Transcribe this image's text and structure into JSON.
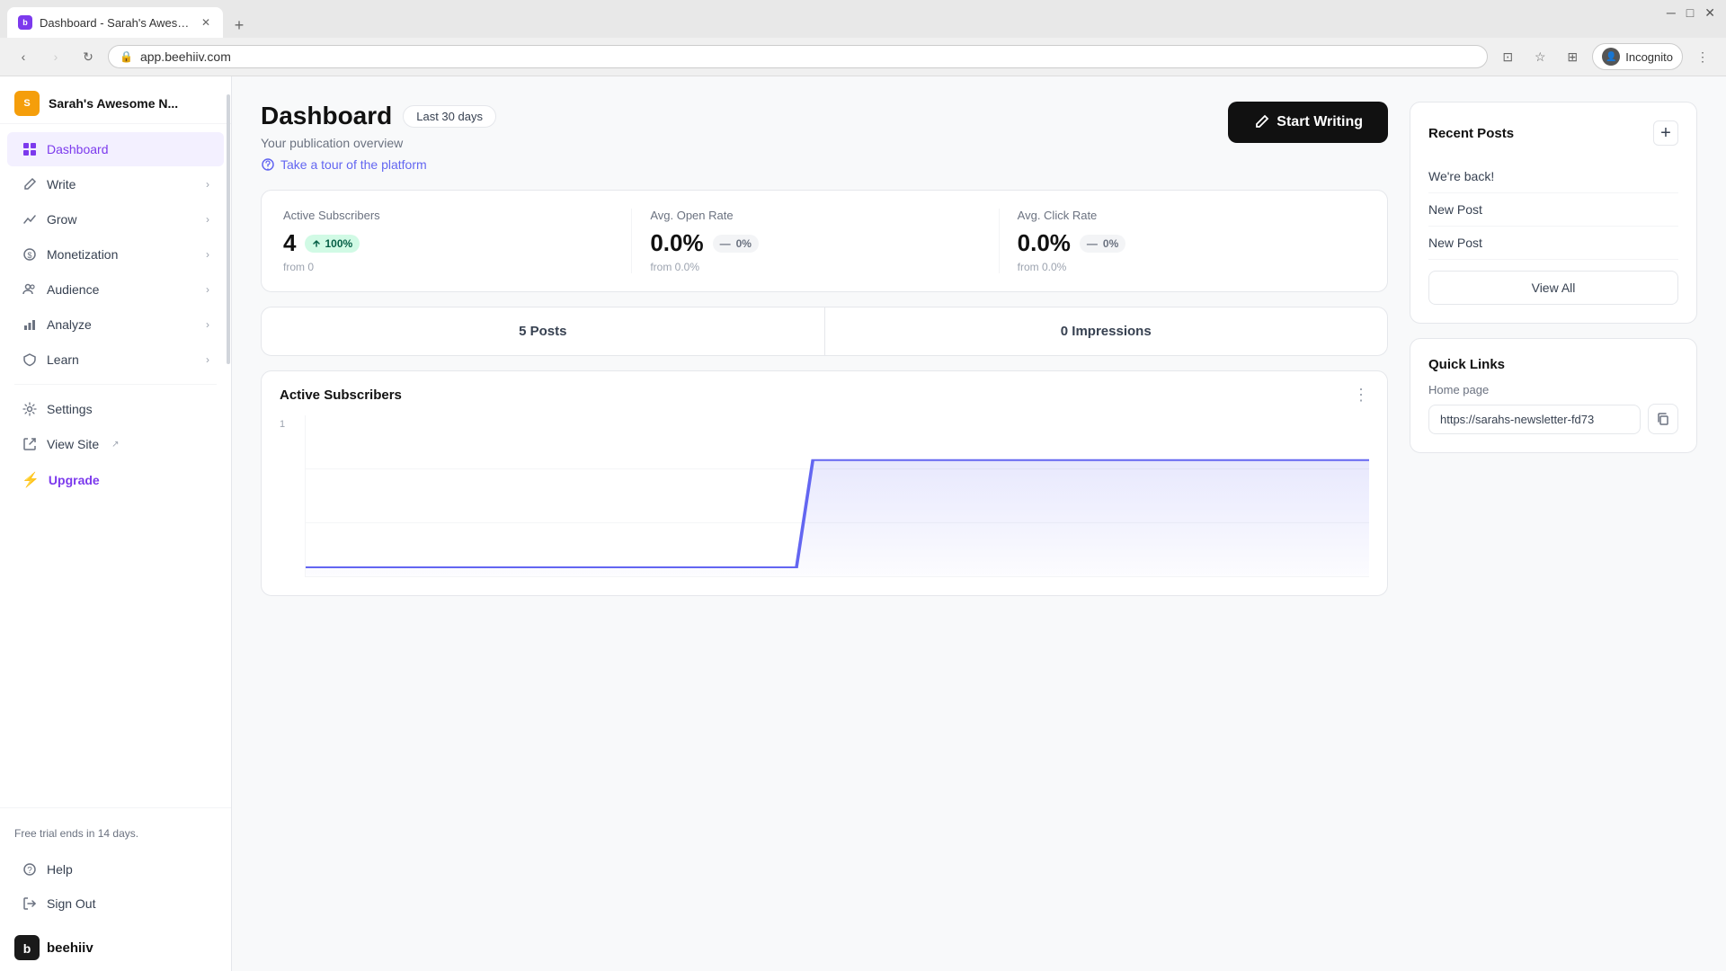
{
  "browser": {
    "tab_title": "Dashboard - Sarah's Awesome N...",
    "url": "app.beehiiv.com",
    "incognito_label": "Incognito"
  },
  "sidebar": {
    "publication_name": "Sarah's Awesome N...",
    "nav_items": [
      {
        "id": "dashboard",
        "label": "Dashboard",
        "icon": "⊞",
        "active": true,
        "has_chevron": false
      },
      {
        "id": "write",
        "label": "Write",
        "icon": "✎",
        "active": false,
        "has_chevron": true
      },
      {
        "id": "grow",
        "label": "Grow",
        "icon": "↗",
        "active": false,
        "has_chevron": true
      },
      {
        "id": "monetization",
        "label": "Monetization",
        "icon": "💰",
        "active": false,
        "has_chevron": true
      },
      {
        "id": "audience",
        "label": "Audience",
        "icon": "👥",
        "active": false,
        "has_chevron": true
      },
      {
        "id": "analyze",
        "label": "Analyze",
        "icon": "📊",
        "active": false,
        "has_chevron": true
      },
      {
        "id": "learn",
        "label": "Learn",
        "icon": "🎓",
        "active": false,
        "has_chevron": true
      }
    ],
    "bottom_items": [
      {
        "id": "settings",
        "label": "Settings",
        "icon": "⚙"
      },
      {
        "id": "view-site",
        "label": "View Site",
        "icon": "↗",
        "external": true
      },
      {
        "id": "upgrade",
        "label": "Upgrade",
        "icon": "⚡",
        "special": true
      }
    ],
    "trial_notice": "Free trial ends in 14 days.",
    "help_label": "Help",
    "sign_out_label": "Sign Out",
    "logo_text": "beehiiv"
  },
  "dashboard": {
    "title": "Dashboard",
    "date_badge": "Last 30 days",
    "subtitle": "Your publication overview",
    "tour_link": "Take a tour of the platform",
    "start_writing_label": "Start Writing"
  },
  "stats": {
    "active_subscribers": {
      "label": "Active Subscribers",
      "value": "4",
      "badge": "100%",
      "badge_type": "green",
      "from_text": "from 0"
    },
    "avg_open_rate": {
      "label": "Avg. Open Rate",
      "value": "0.0%",
      "badge": "0%",
      "badge_type": "neutral",
      "from_text": "from 0.0%"
    },
    "avg_click_rate": {
      "label": "Avg. Click Rate",
      "value": "0.0%",
      "badge": "0%",
      "badge_type": "neutral",
      "from_text": "from 0.0%"
    }
  },
  "posts_impressions": {
    "posts_label": "5 Posts",
    "impressions_label": "0 Impressions"
  },
  "chart": {
    "title": "Active Subscribers",
    "y_value": "1",
    "menu_icon": "⋮"
  },
  "recent_posts": {
    "title": "Recent Posts",
    "add_icon": "+",
    "posts": [
      {
        "title": "We're back!"
      },
      {
        "title": "New Post"
      },
      {
        "title": "New Post"
      }
    ],
    "view_all_label": "View All"
  },
  "quick_links": {
    "title": "Quick Links",
    "home_page_label": "Home page",
    "home_page_url": "https://sarahs-newsletter-fd73",
    "copy_icon": "⧉"
  }
}
